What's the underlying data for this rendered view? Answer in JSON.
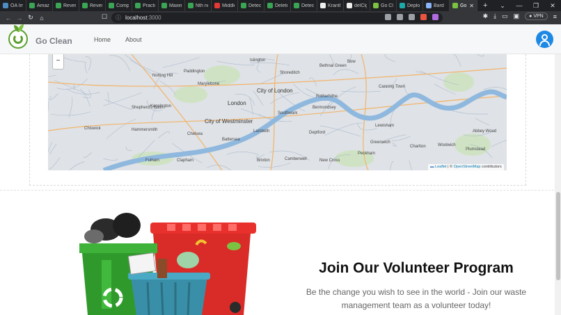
{
  "browser": {
    "tabs": [
      {
        "label": "OA Imp",
        "color": "#4e8cc4"
      },
      {
        "label": "Amazn",
        "color": "#3aa655"
      },
      {
        "label": "Revers",
        "color": "#3aa655"
      },
      {
        "label": "Revers",
        "color": "#3aa655"
      },
      {
        "label": "Compu",
        "color": "#3aa655"
      },
      {
        "label": "Practic",
        "color": "#3aa655"
      },
      {
        "label": "Maxim",
        "color": "#3aa655"
      },
      {
        "label": "Nth no",
        "color": "#3aa655"
      },
      {
        "label": "Middle",
        "color": "#e53935"
      },
      {
        "label": "Detect",
        "color": "#3aa655"
      },
      {
        "label": "Delete",
        "color": "#3aa655"
      },
      {
        "label": "Detect",
        "color": "#3aa655"
      },
      {
        "label": "Kranth",
        "color": "#eeeeee"
      },
      {
        "label": "delClg",
        "color": "#eeeeee"
      },
      {
        "label": "Go Cle",
        "color": "#7cc242"
      },
      {
        "label": "Deploy",
        "color": "#1ba9a9"
      },
      {
        "label": "Bard",
        "color": "#8ab4f8"
      },
      {
        "label": "Go",
        "color": "#7cc242"
      }
    ],
    "address": {
      "host": "localhost",
      "port": ":3000"
    },
    "vpn_label": "VPN"
  },
  "header": {
    "brand": "Go Clean",
    "nav": [
      {
        "label": "Home"
      },
      {
        "label": "About"
      }
    ]
  },
  "map": {
    "zoom_out": "−",
    "attribution": {
      "leaflet": "Leaflet",
      "sep": " | © ",
      "osm": "OpenStreetMap",
      "rest": " contributors"
    },
    "labels": [
      "Notting Hill",
      "Paddington",
      "Marylebone",
      "Islington",
      "Shoreditch",
      "Bethnal Green",
      "Bow",
      "Canning Town",
      "Kensington",
      "City of Westminster",
      "City of London",
      "London",
      "Southwark",
      "Bermondsey",
      "Rotherhithe",
      "Greenwich",
      "Peckham",
      "Brixton",
      "Clapham",
      "Battersea",
      "Chelsea",
      "Fulham",
      "Hammersmith",
      "Shepherd's Bush",
      "Chiswick",
      "Lambeth",
      "Deptford",
      "Woolwich",
      "Plumstead",
      "Abbey Wood",
      "Charlton",
      "Lewisham",
      "New Cross",
      "Camberwell"
    ]
  },
  "volunteer": {
    "title": "Join Our Volunteer Program",
    "subtitle": "Be the change you wish to see in the world - Join our waste management team as a volunteer today!"
  }
}
